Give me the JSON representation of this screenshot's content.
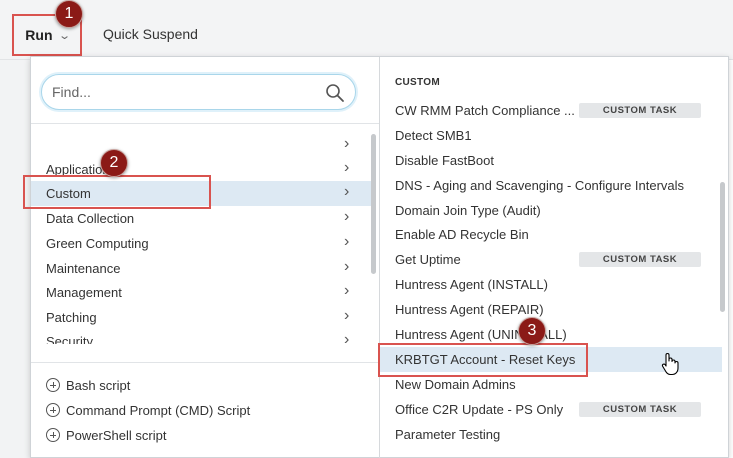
{
  "toolbar": {
    "run_label": "Run",
    "quick_suspend_label": "Quick Suspend"
  },
  "search": {
    "placeholder": "Find..."
  },
  "categories": [
    {
      "label": ""
    },
    {
      "label": "Application"
    },
    {
      "label": "Custom"
    },
    {
      "label": "Data Collection"
    },
    {
      "label": "Green Computing"
    },
    {
      "label": "Maintenance"
    },
    {
      "label": "Management"
    },
    {
      "label": "Patching"
    },
    {
      "label": "Security"
    }
  ],
  "selected_category": "Custom",
  "scripts": [
    {
      "label": "Bash script"
    },
    {
      "label": "Command Prompt (CMD) Script"
    },
    {
      "label": "PowerShell script"
    }
  ],
  "task_section": {
    "heading": "CUSTOM",
    "tasks": [
      {
        "label": "CW RMM Patch Compliance ...",
        "badge": "CUSTOM TASK"
      },
      {
        "label": "Detect SMB1"
      },
      {
        "label": "Disable FastBoot"
      },
      {
        "label": "DNS - Aging and Scavenging - Configure Intervals"
      },
      {
        "label": "Domain Join Type (Audit)"
      },
      {
        "label": "Enable AD Recycle Bin"
      },
      {
        "label": "Get Uptime",
        "badge": "CUSTOM TASK"
      },
      {
        "label": "Huntress Agent (INSTALL)"
      },
      {
        "label": "Huntress Agent (REPAIR)"
      },
      {
        "label": "Huntress Agent (UNINSTALL)"
      },
      {
        "label": "KRBTGT Account - Reset Keys"
      },
      {
        "label": "New Domain Admins"
      },
      {
        "label": "Office C2R Update - PS Only",
        "badge": "CUSTOM TASK"
      },
      {
        "label": "Parameter Testing"
      }
    ]
  },
  "callouts": [
    "1",
    "2",
    "3"
  ],
  "colors": {
    "highlight": "#d9534f",
    "callout": "#8b1a17",
    "selected_row": "#dde9f3",
    "badge_bg": "#e4e6e8"
  }
}
